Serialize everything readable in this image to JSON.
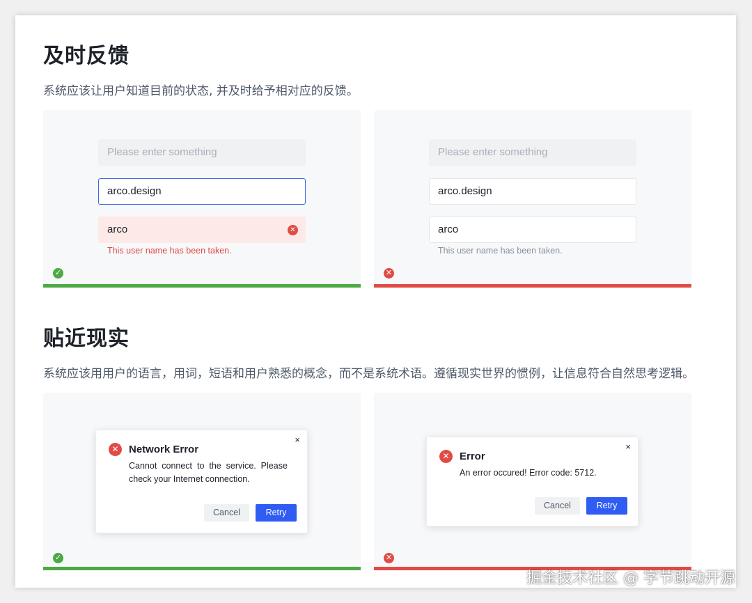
{
  "section1": {
    "title": "及时反馈",
    "description": "系统应该让用户知道目前的状态, 并及时给予相对应的反馈。",
    "good_example": {
      "placeholder_field": "Please enter something",
      "focused_field": "arco.design",
      "error_field": "arco",
      "error_message": "This user name has been taken.",
      "status": "good",
      "badge_icon": "check-circle-icon"
    },
    "bad_example": {
      "placeholder_field": "Please enter something",
      "field_one": "arco.design",
      "field_two": "arco",
      "help_message": "This user name has been taken.",
      "status": "bad",
      "badge_icon": "close-circle-icon"
    }
  },
  "section2": {
    "title": "贴近现实",
    "description": "系统应该用用户的语言，用词，短语和用户熟悉的概念，而不是系统术语。遵循现实世界的惯例，让信息符合自然思考逻辑。",
    "good_example": {
      "dialog_title": "Network Error",
      "dialog_body_line1": "Cannot  connect  to  the  service.  Please",
      "dialog_body_line2": "check your Internet connection.",
      "cancel_label": "Cancel",
      "retry_label": "Retry",
      "close_glyph": "×",
      "status": "good"
    },
    "bad_example": {
      "dialog_title": "Error",
      "dialog_body": "An error occured! Error code: 5712.",
      "cancel_label": "Cancel",
      "retry_label": "Retry",
      "close_glyph": "×",
      "status": "bad"
    }
  },
  "watermark": "掘金技术社区 @ 字节跳动开源",
  "colors": {
    "good": "#4ca944",
    "bad": "#e24b45",
    "primary": "#2f5cf3",
    "focus_border": "#3c6be4",
    "panel_bg": "#f7f8fa"
  }
}
